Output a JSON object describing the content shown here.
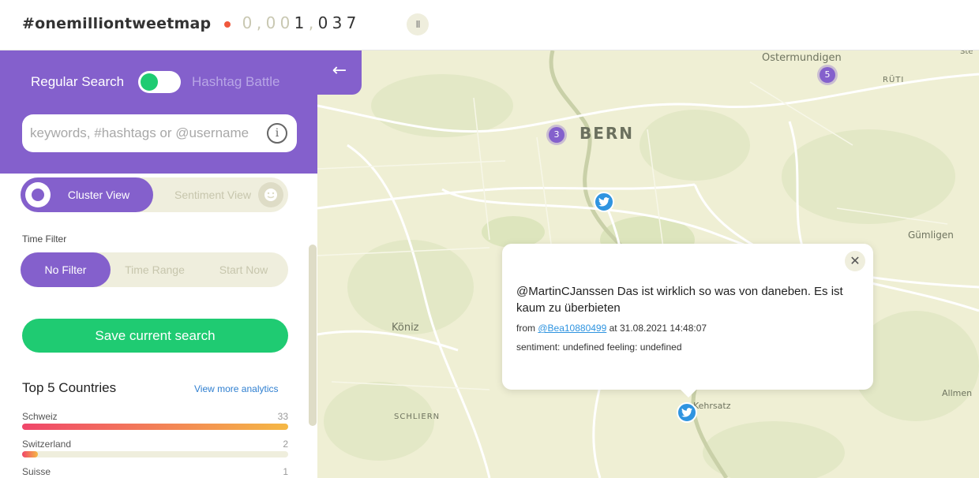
{
  "header": {
    "brand": "#onemilliontweetmap",
    "counter_digits": [
      {
        "d": "0",
        "s": "dim"
      },
      {
        "d": ",",
        "s": "sep"
      },
      {
        "d": "0",
        "s": "dim"
      },
      {
        "d": "0",
        "s": "dim"
      },
      {
        "d": "1",
        "s": "on"
      },
      {
        "d": ",",
        "s": "sep"
      },
      {
        "d": "0",
        "s": "on"
      },
      {
        "d": "3",
        "s": "on"
      },
      {
        "d": "7",
        "s": "on"
      }
    ],
    "pause_label": "II"
  },
  "panel": {
    "mode_regular": "Regular Search",
    "mode_battle": "Hashtag Battle",
    "search_placeholder": "keywords, #hashtags or @username",
    "info_glyph": "i",
    "view": {
      "cluster": "Cluster View",
      "sentiment": "Sentiment View"
    },
    "time_filter_label": "Time Filter",
    "time_options": [
      "No Filter",
      "Time Range",
      "Start Now"
    ],
    "save_label": "Save current search",
    "top5_title": "Top 5 Countries",
    "more_link": "View more analytics",
    "countries": [
      {
        "name": "Schweiz",
        "count": "33",
        "share": 1.0
      },
      {
        "name": "Switzerland",
        "count": "2",
        "share": 0.06
      },
      {
        "name": "Suisse",
        "count": "1",
        "share": 0.03
      }
    ]
  },
  "map": {
    "places": [
      "Ostermundigen",
      "RÜTI",
      "BERN",
      "Gümligen",
      "Köniz",
      "SCHLIERN",
      "Kehrsatz",
      "Allmen",
      "Ste"
    ],
    "clusters": [
      "5",
      "3"
    ]
  },
  "popup": {
    "text": "@MartinCJanssen Das ist wirklich so was von daneben. Es ist kaum zu überbieten",
    "from_prefix": "from",
    "user": "@Bea10880499",
    "at_text": "at 31.08.2021 14:48:07",
    "sentiment": "sentiment: undefined feeling: undefined",
    "close_glyph": "✕"
  },
  "colors": {
    "accent": "#8460cc",
    "green": "#1fcb72",
    "twitter": "#2f94e0",
    "map": "#efefd4"
  }
}
